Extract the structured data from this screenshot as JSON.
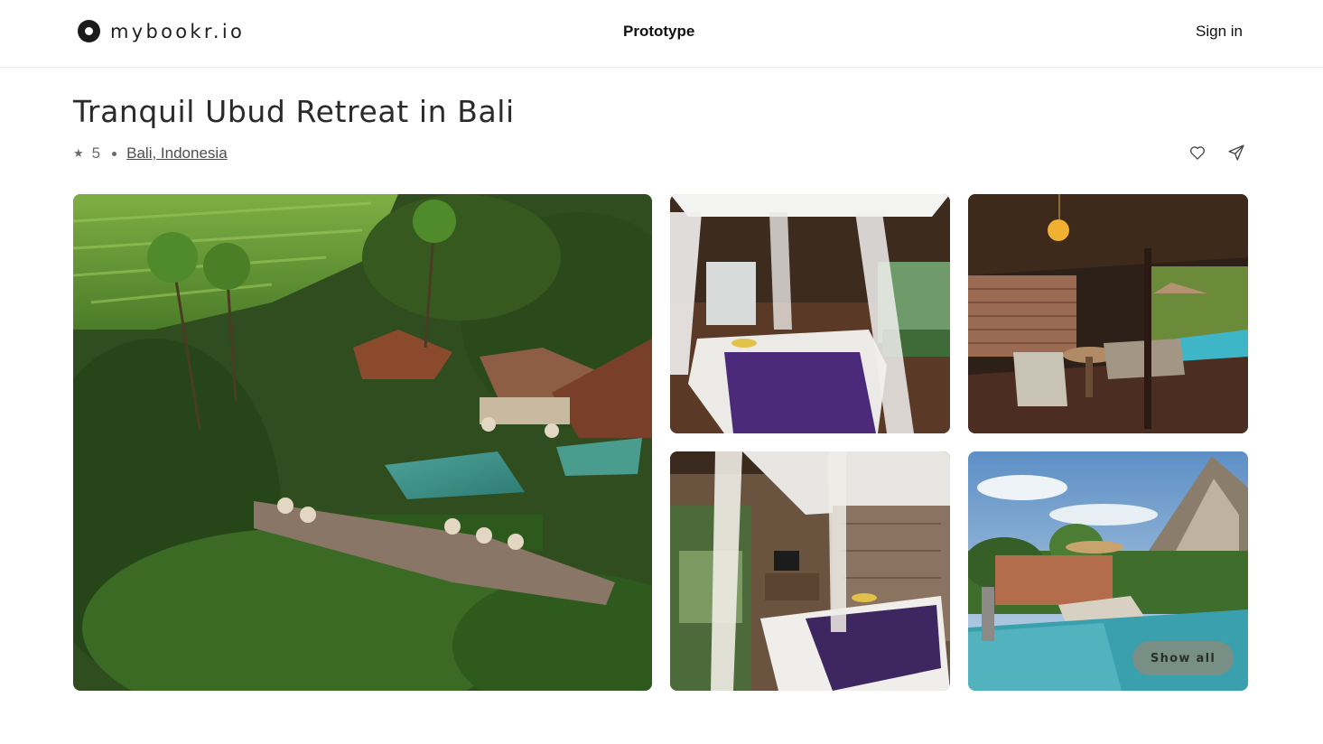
{
  "header": {
    "brand": "mybookr.io",
    "center_label": "Prototype",
    "signin_label": "Sign in"
  },
  "listing": {
    "title": "Tranquil Ubud Retreat in Bali",
    "rating": "5",
    "location": "Bali, Indonesia"
  },
  "icons": {
    "star": "star-icon",
    "save": "heart-icon",
    "share": "share-icon",
    "logo": "brand-logo-icon"
  },
  "gallery": {
    "photos": [
      "aerial-view-of-resort-in-jungle",
      "canopy-bed-with-white-drapes",
      "covered-patio-with-private-pool",
      "bedroom-with-carved-wood-panels",
      "garden-pool-with-sun-loungers"
    ],
    "show_all_label": "Show all"
  },
  "colors": {
    "text_primary": "#222222",
    "text_muted": "#6a6a6a",
    "divider": "#ececec",
    "show_all_bg": "#808c80"
  }
}
